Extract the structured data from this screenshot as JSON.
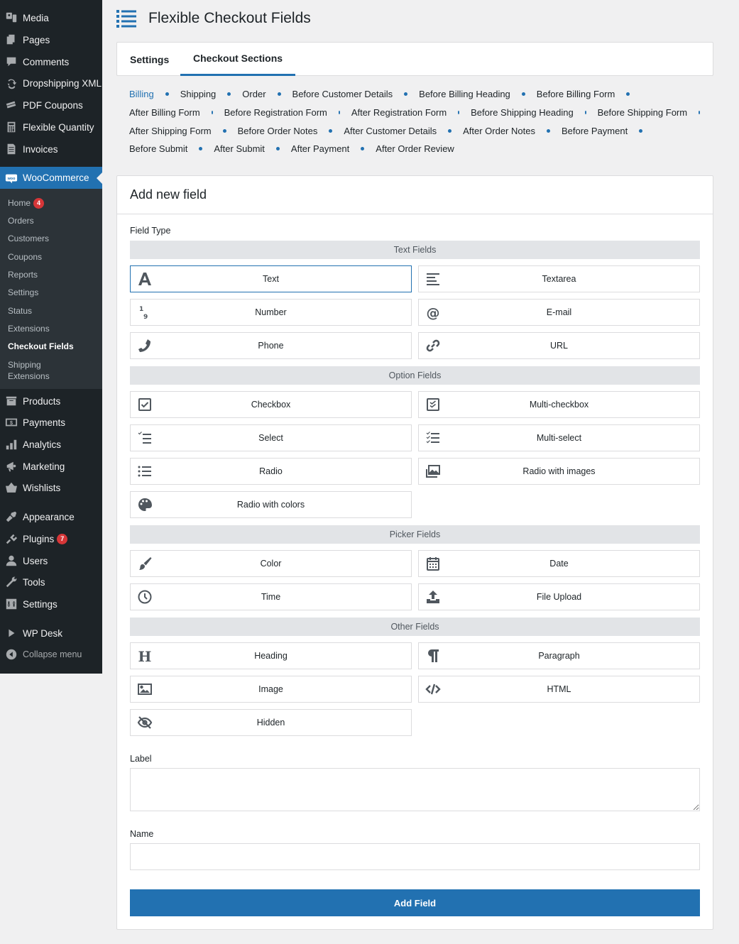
{
  "sidebar": {
    "top_items": [
      {
        "label": "Media",
        "icon": "media-icon"
      },
      {
        "label": "Pages",
        "icon": "pages-icon"
      },
      {
        "label": "Comments",
        "icon": "comments-icon"
      },
      {
        "label": "Dropshipping XML",
        "icon": "dropshipping-icon"
      },
      {
        "label": "PDF Coupons",
        "icon": "coupons-icon"
      },
      {
        "label": "Flexible Quantity",
        "icon": "calculator-icon"
      },
      {
        "label": "Invoices",
        "icon": "invoice-icon"
      }
    ],
    "woocommerce": {
      "label": "WooCommerce",
      "icon": "woo-icon"
    },
    "submenu": [
      {
        "label": "Home",
        "badge": "4"
      },
      {
        "label": "Orders"
      },
      {
        "label": "Customers"
      },
      {
        "label": "Coupons"
      },
      {
        "label": "Reports"
      },
      {
        "label": "Settings"
      },
      {
        "label": "Status"
      },
      {
        "label": "Extensions"
      },
      {
        "label": "Checkout Fields",
        "current": true
      },
      {
        "label": "Shipping Extensions"
      }
    ],
    "bottom_items": [
      {
        "label": "Products",
        "icon": "products-icon"
      },
      {
        "label": "Payments",
        "icon": "payments-icon"
      },
      {
        "label": "Analytics",
        "icon": "analytics-icon"
      },
      {
        "label": "Marketing",
        "icon": "megaphone-icon"
      },
      {
        "label": "Wishlists",
        "icon": "wishlist-icon"
      },
      {
        "label": "Appearance",
        "icon": "brush-icon"
      },
      {
        "label": "Plugins",
        "icon": "plugin-icon",
        "badge": "7"
      },
      {
        "label": "Users",
        "icon": "user-icon"
      },
      {
        "label": "Tools",
        "icon": "wrench-icon"
      },
      {
        "label": "Settings",
        "icon": "settings-icon"
      },
      {
        "label": "WP Desk",
        "icon": "play-icon"
      }
    ],
    "collapse_label": "Collapse menu"
  },
  "header": {
    "title": "Flexible Checkout Fields"
  },
  "tabs": [
    {
      "label": "Settings",
      "active": false
    },
    {
      "label": "Checkout Sections",
      "active": true
    }
  ],
  "sections": [
    [
      "Billing",
      "Shipping",
      "Order",
      "Before Customer Details",
      "Before Billing Heading",
      "Before Billing Form"
    ],
    [
      "After Billing Form",
      "Before Registration Form",
      "After Registration Form",
      "Before Shipping Heading",
      "Before Shipping Form"
    ],
    [
      "After Shipping Form",
      "Before Order Notes",
      "After Customer Details",
      "After Order Notes",
      "Before Payment"
    ],
    [
      "Before Submit",
      "After Submit",
      "After Payment",
      "After Order Review"
    ]
  ],
  "active_section": "Billing",
  "card": {
    "title": "Add new field",
    "field_type_label": "Field Type",
    "groups": [
      {
        "title": "Text Fields",
        "items": [
          {
            "label": "Text",
            "icon": "text-icon",
            "selected": true
          },
          {
            "label": "Textarea",
            "icon": "textarea-icon"
          },
          {
            "label": "Number",
            "icon": "number-icon"
          },
          {
            "label": "E-mail",
            "icon": "at-icon"
          },
          {
            "label": "Phone",
            "icon": "phone-icon"
          },
          {
            "label": "URL",
            "icon": "link-icon"
          }
        ]
      },
      {
        "title": "Option Fields",
        "items": [
          {
            "label": "Checkbox",
            "icon": "checkbox-icon"
          },
          {
            "label": "Multi-checkbox",
            "icon": "multi-checkbox-icon"
          },
          {
            "label": "Select",
            "icon": "select-icon"
          },
          {
            "label": "Multi-select",
            "icon": "multi-select-icon"
          },
          {
            "label": "Radio",
            "icon": "list-icon"
          },
          {
            "label": "Radio with images",
            "icon": "images-icon"
          },
          {
            "label": "Radio with colors",
            "icon": "palette-icon"
          }
        ]
      },
      {
        "title": "Picker Fields",
        "items": [
          {
            "label": "Color",
            "icon": "brush-icon"
          },
          {
            "label": "Date",
            "icon": "calendar-icon"
          },
          {
            "label": "Time",
            "icon": "clock-icon"
          },
          {
            "label": "File Upload",
            "icon": "upload-icon"
          }
        ]
      },
      {
        "title": "Other Fields",
        "items": [
          {
            "label": "Heading",
            "icon": "heading-icon"
          },
          {
            "label": "Paragraph",
            "icon": "paragraph-icon"
          },
          {
            "label": "Image",
            "icon": "image-icon"
          },
          {
            "label": "HTML",
            "icon": "code-icon"
          },
          {
            "label": "Hidden",
            "icon": "eye-slash-icon"
          }
        ]
      }
    ],
    "label_field": {
      "label": "Label",
      "value": ""
    },
    "name_field": {
      "label": "Name",
      "value": ""
    },
    "submit_label": "Add Field"
  },
  "colors": {
    "accent": "#2271b1",
    "sidebar_bg": "#1d2327",
    "submenu_bg": "#2c3338",
    "badge": "#d63638"
  }
}
